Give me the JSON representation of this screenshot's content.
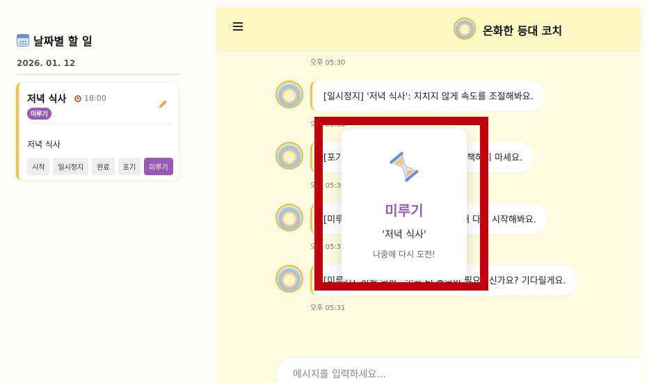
{
  "sidebar": {
    "title": "날짜별 할 일",
    "date": "2026. 01. 12",
    "task": {
      "title": "저녁 식사",
      "time": "18:00",
      "status": "미루기",
      "name": "저녁 식사",
      "actions": [
        "시작",
        "일시정지",
        "완료",
        "포기",
        "미루기"
      ],
      "active_action": "미루기"
    }
  },
  "chat": {
    "header_title": "온화한 등대 코치",
    "messages": [
      {
        "time": "오후 05:30"
      },
      {
        "text": "[일시정지] '저녁 식사': 지치지 않게 속도를 조절해봐요.",
        "time": "오후 05:30"
      },
      {
        "text": "[포기] '저녁 식사': 멈출 수도 있죠. 자책하지 마세요.",
        "time": "오후 05:30"
      },
      {
        "text": "[미루기] '저녁 식사': 마음이 편안할 때 다시 시작해봐요.",
        "time": "오후 05:31"
      },
      {
        "text": "[미루기] '저녁 식사': 조금 더 휴식이 필요하신가요? 기다릴게요.",
        "time": "오후 05:31"
      }
    ],
    "input_placeholder": "메시지를 입력하세요..."
  },
  "popup": {
    "title": "미루기",
    "task": "'저녁 식사'",
    "subtitle": "나중에 다시 도전!"
  },
  "colors": {
    "accent_yellow": "#f5c342",
    "postpone_purple": "#9b59b6",
    "chat_bg": "#fffbe0",
    "highlight_red": "#c1000d"
  },
  "icons": [
    "calendar-icon",
    "alarm-clock-icon",
    "pencil-icon",
    "menu-icon",
    "hourglass-icon"
  ]
}
